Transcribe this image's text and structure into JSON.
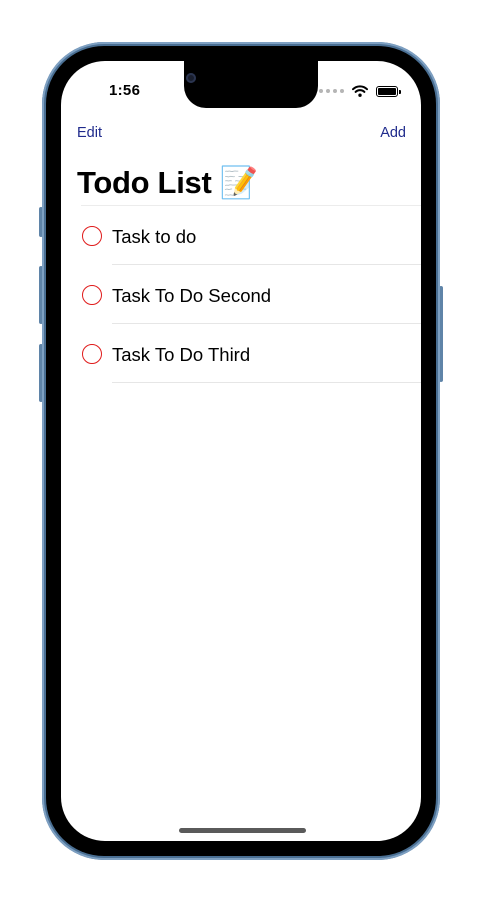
{
  "status_bar": {
    "time": "1:56",
    "icons": [
      "cellular-dots-icon",
      "wifi-icon",
      "battery-icon"
    ]
  },
  "nav": {
    "edit_label": "Edit",
    "add_label": "Add",
    "title": "Todo List 📝",
    "accent_color": "#1f2a8c"
  },
  "tasks": [
    {
      "label": "Task to do"
    },
    {
      "label": "Task To Do Second"
    },
    {
      "label": "Task To Do Third"
    }
  ],
  "colors": {
    "radio_ring": "#e01b1b",
    "frame": "#4a6f93"
  }
}
